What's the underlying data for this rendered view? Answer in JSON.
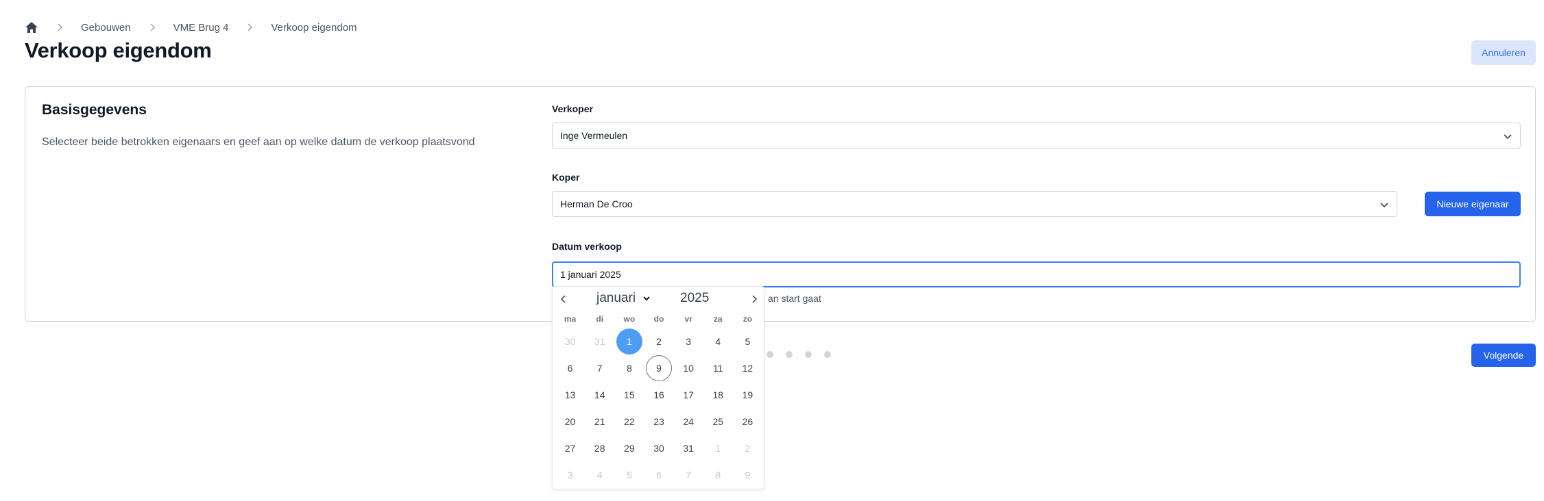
{
  "breadcrumb": {
    "home_icon": "home-icon",
    "items": [
      "Gebouwen",
      "VME Brug 4",
      "Verkoop eigendom"
    ]
  },
  "page": {
    "title": "Verkoop eigendom",
    "cancel_label": "Annuleren"
  },
  "card": {
    "title": "Basisgegevens",
    "description": "Selecteer beide betrokken eigenaars en geef aan op welke datum de verkoop plaatsvond"
  },
  "form": {
    "verkoper": {
      "label": "Verkoper",
      "value": "Inge Vermeulen"
    },
    "koper": {
      "label": "Koper",
      "value": "Herman De Croo",
      "new_owner_label": "Nieuwe eigenaar"
    },
    "datum": {
      "label": "Datum verkoop",
      "value": "1 januari 2025",
      "hint_partial": "an start gaat"
    }
  },
  "stepper": {
    "step_count": 4
  },
  "footer": {
    "next_label": "Volgende"
  },
  "calendar": {
    "month": "januari",
    "year": "2025",
    "weekdays": [
      "ma",
      "di",
      "wo",
      "do",
      "vr",
      "za",
      "zo"
    ],
    "days": [
      {
        "d": "30",
        "muted": true
      },
      {
        "d": "31",
        "muted": true
      },
      {
        "d": "1",
        "selected": true
      },
      {
        "d": "2"
      },
      {
        "d": "3"
      },
      {
        "d": "4"
      },
      {
        "d": "5"
      },
      {
        "d": "6"
      },
      {
        "d": "7"
      },
      {
        "d": "8"
      },
      {
        "d": "9",
        "today": true
      },
      {
        "d": "10"
      },
      {
        "d": "11"
      },
      {
        "d": "12"
      },
      {
        "d": "13"
      },
      {
        "d": "14"
      },
      {
        "d": "15"
      },
      {
        "d": "16"
      },
      {
        "d": "17"
      },
      {
        "d": "18"
      },
      {
        "d": "19"
      },
      {
        "d": "20"
      },
      {
        "d": "21"
      },
      {
        "d": "22"
      },
      {
        "d": "23"
      },
      {
        "d": "24"
      },
      {
        "d": "25"
      },
      {
        "d": "26"
      },
      {
        "d": "27"
      },
      {
        "d": "28"
      },
      {
        "d": "29"
      },
      {
        "d": "30"
      },
      {
        "d": "31"
      },
      {
        "d": "1",
        "muted": true
      },
      {
        "d": "2",
        "muted": true
      },
      {
        "d": "3",
        "muted": true
      },
      {
        "d": "4",
        "muted": true
      },
      {
        "d": "5",
        "muted": true
      },
      {
        "d": "6",
        "muted": true
      },
      {
        "d": "7",
        "muted": true
      },
      {
        "d": "8",
        "muted": true
      },
      {
        "d": "9",
        "muted": true
      }
    ]
  },
  "colors": {
    "primary": "#2563eb",
    "focus": "#3b82f6",
    "selected_day": "#4f9cf5",
    "cancel_bg": "#dbe5fb"
  }
}
